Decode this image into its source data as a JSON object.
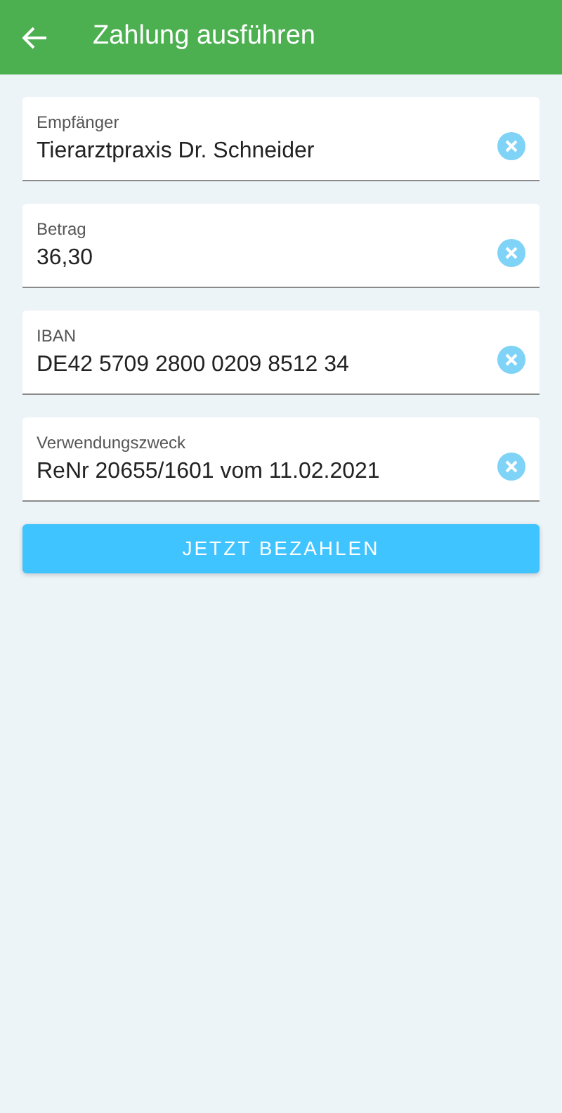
{
  "app_bar": {
    "title": "Zahlung ausführen"
  },
  "fields": [
    {
      "label": "Empfänger",
      "value": "Tierarztpraxis Dr. Schneider"
    },
    {
      "label": "Betrag",
      "value": "36,30"
    },
    {
      "label": "IBAN",
      "value": "DE42 5709 2800 0209 8512 34"
    },
    {
      "label": "Verwendungszweck",
      "value": "ReNr 20655/1601 vom 11.02.2021"
    }
  ],
  "submit_button": {
    "label": "JETZT BEZAHLEN"
  }
}
